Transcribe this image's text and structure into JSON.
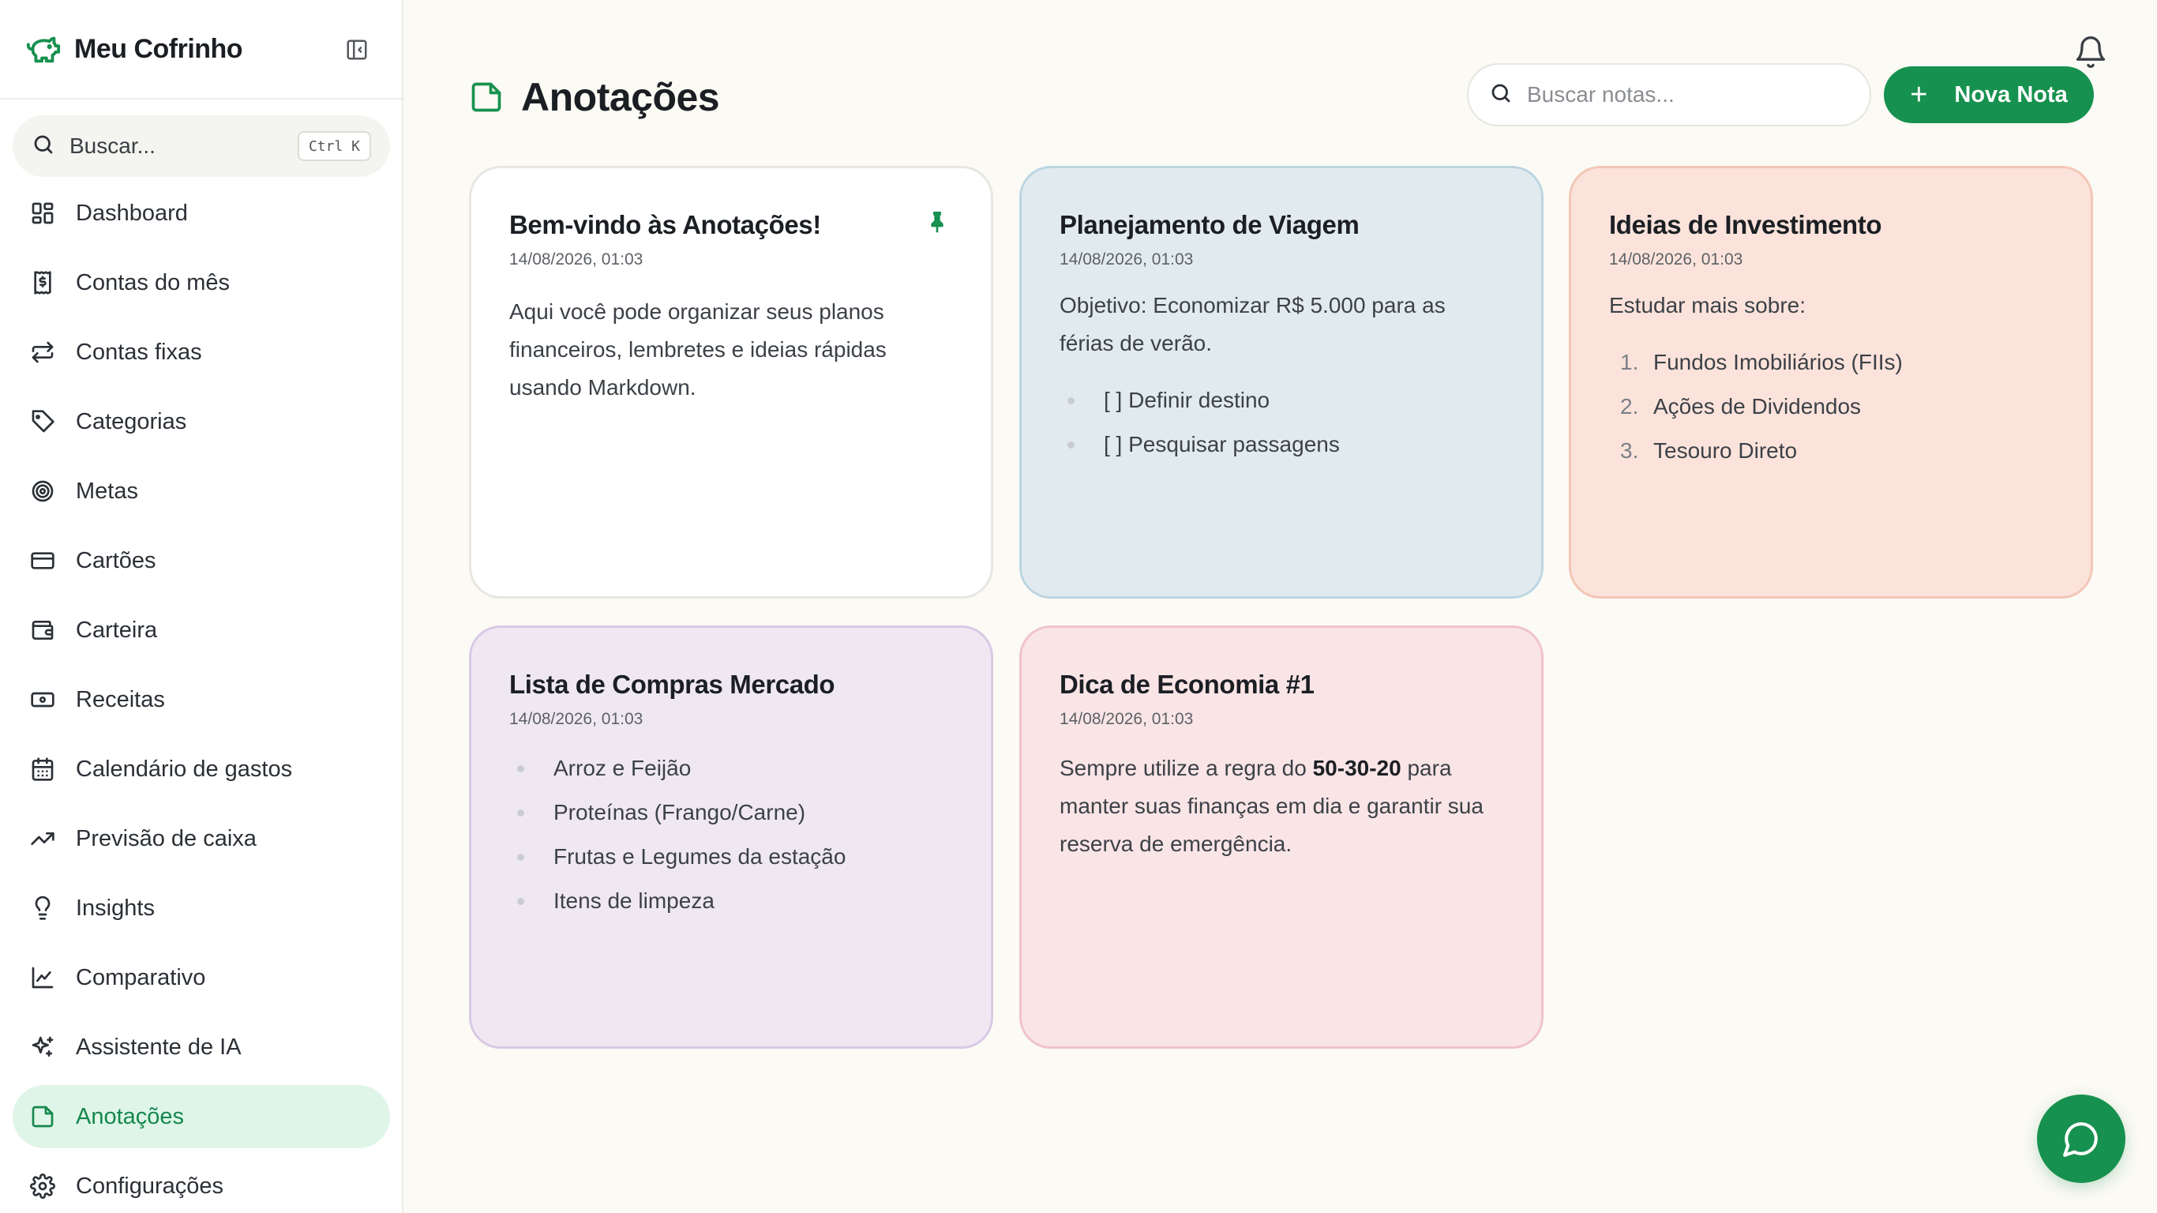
{
  "app": {
    "name": "Meu Cofrinho"
  },
  "sidebar": {
    "search_label": "Buscar...",
    "search_shortcut": "Ctrl K",
    "items": [
      {
        "label": "Dashboard",
        "icon": "dashboard-icon"
      },
      {
        "label": "Contas do mês",
        "icon": "bill-icon"
      },
      {
        "label": "Contas fixas",
        "icon": "repeat-icon"
      },
      {
        "label": "Categorias",
        "icon": "tag-icon"
      },
      {
        "label": "Metas",
        "icon": "target-icon"
      },
      {
        "label": "Cartões",
        "icon": "credit-card-icon"
      },
      {
        "label": "Carteira",
        "icon": "wallet-icon"
      },
      {
        "label": "Receitas",
        "icon": "banknote-icon"
      },
      {
        "label": "Calendário de gastos",
        "icon": "calendar-icon"
      },
      {
        "label": "Previsão de caixa",
        "icon": "trend-up-icon"
      },
      {
        "label": "Insights",
        "icon": "lightbulb-icon"
      },
      {
        "label": "Comparativo",
        "icon": "line-chart-icon"
      },
      {
        "label": "Assistente de IA",
        "icon": "sparkles-icon"
      },
      {
        "label": "Anotações",
        "icon": "note-icon",
        "active": true
      },
      {
        "label": "Configurações",
        "icon": "gear-icon"
      }
    ]
  },
  "header": {
    "title": "Anotações",
    "search_placeholder": "Buscar notas...",
    "new_note_label": "Nova Nota"
  },
  "colors": {
    "accent": "#17914f",
    "active_bg": "#dff5e8"
  },
  "notes": [
    {
      "title": "Bem-vindo às Anotações!",
      "date": "14/08/2026, 01:03",
      "body": "Aqui você pode organizar seus planos financeiros, lembretes e ideias rápidas usando Markdown.",
      "pinned": true,
      "color": "#ffffff"
    },
    {
      "title": "Planejamento de Viagem",
      "date": "14/08/2026, 01:03",
      "body": "Objetivo: Economizar R$ 5.000 para as férias de verão.",
      "items": [
        "[ ] Definir destino",
        "[ ] Pesquisar passagens"
      ],
      "color": "#e1ebef"
    },
    {
      "title": "Ideias de Investimento",
      "date": "14/08/2026, 01:03",
      "body": "Estudar mais sobre:",
      "ordered": [
        "Fundos Imobiliários (FIIs)",
        "Ações de Dividendos",
        "Tesouro Direto"
      ],
      "color": "#fbe3db"
    },
    {
      "title": "Lista de Compras Mercado",
      "date": "14/08/2026, 01:03",
      "items": [
        "Arroz e Feijão",
        "Proteínas (Frango/Carne)",
        "Frutas e Legumes da estação",
        "Itens de limpeza"
      ],
      "color": "#efe8f3"
    },
    {
      "title": "Dica de Economia #1",
      "date": "14/08/2026, 01:03",
      "body_before": "Sempre utilize a regra do ",
      "body_bold": "50-30-20",
      "body_after": " para manter suas finanças em dia e garantir sua reserva de emergência.",
      "color": "#f9e4e6"
    }
  ]
}
